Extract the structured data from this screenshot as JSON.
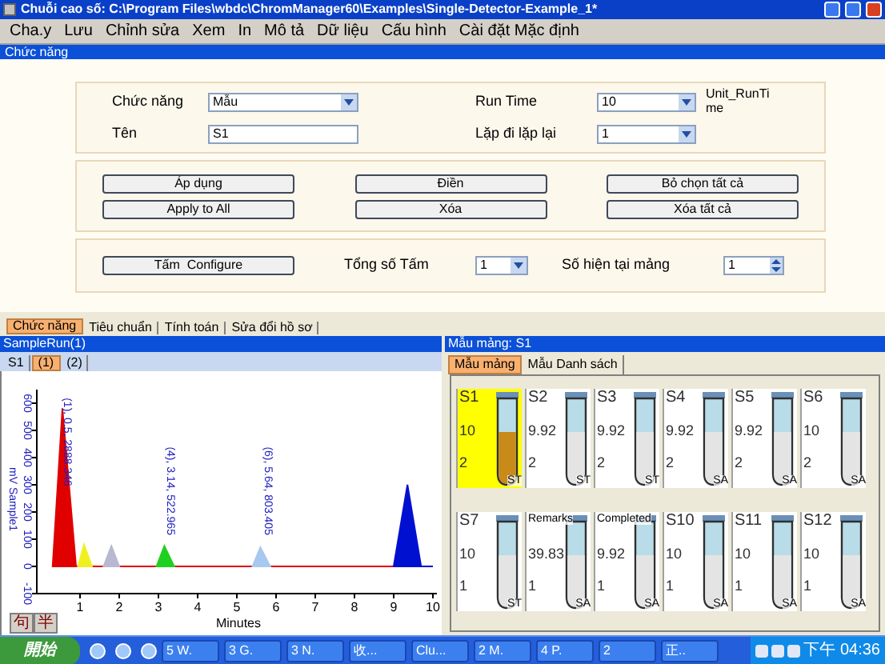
{
  "window": {
    "title": "Chuỗi cao số: C:\\Program Files\\wbdc\\ChromManager60\\Examples\\Single-Detector-Example_1*"
  },
  "menu": [
    "Cha.y",
    "Lưu",
    "Chỉnh sửa",
    "Xem",
    "In",
    "Mô tả",
    "Dữ liệu",
    "Cấu hình",
    "Cài đặt Mặc định"
  ],
  "section_bar": "Chức năng",
  "settings": {
    "function_label": "Chức năng",
    "function_value": "Mẫu",
    "name_label": "Tên",
    "name_value": "S1",
    "run_time_label": "Run Time",
    "run_time_value": "10",
    "unit": "Unit_RunTime",
    "repeat_label": "Lặp đi lặp lại",
    "repeat_value": "1"
  },
  "actions": [
    "Áp dụng",
    "Điền",
    "Bỏ chọn tất cả",
    "Apply to All",
    "Xóa",
    "Xóa tất cả"
  ],
  "tray_config": {
    "button": "Tấm  Configure",
    "total_label": "Tổng số Tấm",
    "total_value": "1",
    "current_label": "Số hiện tại mảng",
    "current_value": "1"
  },
  "bottom_tabs": [
    {
      "label": "Chức năng",
      "selected": true
    },
    {
      "label": "Tiêu chuẩn",
      "selected": false
    },
    {
      "label": "Tính toán",
      "selected": false
    },
    {
      "label": "Sửa đổi hồ sơ",
      "selected": false
    }
  ],
  "run_panel": {
    "title": "SampleRun(1)",
    "tabs": [
      {
        "label": "S1",
        "selected": false
      },
      {
        "label": "(1)",
        "selected": true
      },
      {
        "label": "(2)",
        "selected": false
      }
    ],
    "chart_data": {
      "type": "area",
      "xlabel": "Minutes",
      "ylabel": "mV Sample1",
      "x": [
        0.3,
        0.55,
        0.9,
        0.95,
        1.1,
        1.3,
        1.6,
        1.8,
        2.0,
        2.95,
        3.15,
        3.4,
        5.4,
        5.6,
        5.85,
        9.0,
        9.35,
        9.7,
        10.0
      ],
      "series": [
        {
          "color": "#e00000",
          "values": [
            0,
            580,
            0,
            0,
            0,
            0,
            0,
            0,
            0,
            0,
            0,
            0,
            0,
            0,
            0,
            0,
            0,
            0,
            0
          ]
        },
        {
          "color": "#f0f020",
          "values": [
            null,
            null,
            null,
            0,
            80,
            0,
            null,
            null,
            null,
            null,
            null,
            null,
            null,
            null,
            null,
            null,
            null,
            null,
            null
          ]
        },
        {
          "color": "#b8b8d0",
          "values": [
            null,
            null,
            null,
            null,
            null,
            null,
            0,
            75,
            0,
            null,
            null,
            null,
            null,
            null,
            null,
            null,
            null,
            null,
            null
          ]
        },
        {
          "color": "#20d020",
          "values": [
            null,
            null,
            null,
            null,
            null,
            null,
            null,
            null,
            null,
            0,
            75,
            0,
            null,
            null,
            null,
            null,
            null,
            null,
            null
          ]
        },
        {
          "color": "#a8c8f0",
          "values": [
            null,
            null,
            null,
            null,
            null,
            null,
            null,
            null,
            null,
            null,
            null,
            null,
            0,
            70,
            0,
            null,
            null,
            null,
            null
          ]
        },
        {
          "color": "#0010d0",
          "values": [
            null,
            null,
            null,
            null,
            null,
            null,
            null,
            null,
            null,
            null,
            null,
            null,
            null,
            null,
            null,
            0,
            300,
            0,
            0
          ]
        }
      ],
      "xlim": [
        0,
        10
      ],
      "ylim": [
        -100,
        650
      ],
      "xticks": [
        1,
        2,
        3,
        4,
        5,
        6,
        7,
        8,
        9,
        10
      ],
      "yticks": [
        -100,
        0,
        100,
        200,
        300,
        400,
        500,
        600
      ],
      "annotations": [
        "(1), 0.5, 2888.346",
        "(4), 3.14, 522.965",
        "(6), 5.64, 803.405"
      ]
    }
  },
  "ime_buttons": [
    "句",
    "半"
  ],
  "tray_panel": {
    "title": "Mẫu mảng: S1",
    "tabs": [
      {
        "label": "Mẫu mảng",
        "selected": true
      },
      {
        "label": "Mẫu Danh sách",
        "selected": false
      }
    ],
    "tubes": [
      {
        "label": "S1",
        "value": "10",
        "count": "2",
        "type": "ST",
        "color": "#c88a18",
        "selected": true
      },
      {
        "label": "S2",
        "value": "9.92",
        "count": "2",
        "type": "ST",
        "color": "#e4e4e4",
        "selected": false
      },
      {
        "label": "S3",
        "value": "9.92",
        "count": "2",
        "type": "ST",
        "color": "#e4e4e4",
        "selected": false
      },
      {
        "label": "S4",
        "value": "9.92",
        "count": "2",
        "type": "SA",
        "color": "#e4e4e4",
        "selected": false
      },
      {
        "label": "S5",
        "value": "9.92",
        "count": "2",
        "type": "SA",
        "color": "#e4e4e4",
        "selected": false
      },
      {
        "label": "S6",
        "value": "10",
        "count": "2",
        "type": "SA",
        "color": "#e4e4e4",
        "selected": false
      },
      {
        "label": "S7",
        "value": "10",
        "count": "1",
        "type": "ST",
        "color": "#e4e4e4",
        "selected": false
      },
      {
        "label": "Remarks",
        "value": "39.83",
        "count": "1",
        "type": "SA",
        "color": "#e4e4e4",
        "selected": false
      },
      {
        "label": "Completed",
        "value": "9.92",
        "count": "1",
        "type": "SA",
        "color": "#e4e4e4",
        "selected": false
      },
      {
        "label": "S10",
        "value": "10",
        "count": "1",
        "type": "SA",
        "color": "#e4e4e4",
        "selected": false
      },
      {
        "label": "S11",
        "value": "10",
        "count": "1",
        "type": "SA",
        "color": "#e4e4e4",
        "selected": false
      },
      {
        "label": "S12",
        "value": "10",
        "count": "1",
        "type": "SA",
        "color": "#e4e4e4",
        "selected": false
      }
    ]
  },
  "taskbar": {
    "start": "開始",
    "tasks": [
      "5 W.",
      "3 G.",
      "3 N.",
      "收...",
      "Clu...",
      "2 M.",
      "4 P.",
      "2",
      "正.."
    ],
    "clock": "下午 04:36"
  }
}
